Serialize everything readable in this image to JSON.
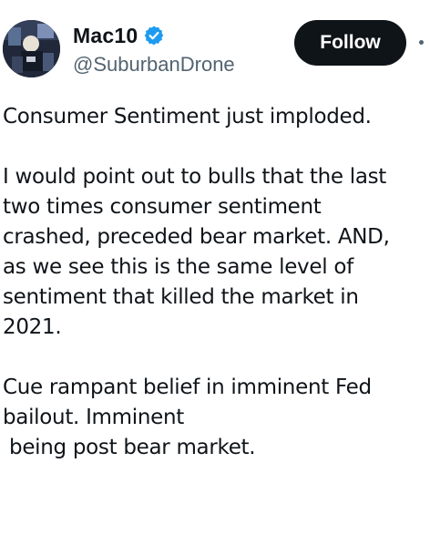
{
  "author": {
    "display_name": "Mac10",
    "handle": "@SuburbanDrone",
    "verified_icon": "verified-badge-icon",
    "verified_color": "#1d9bf0"
  },
  "actions": {
    "follow_label": "Follow"
  },
  "tweet": {
    "paragraphs": [
      "Consumer Sentiment just imploded.",
      "I would point out to bulls that the last\ntwo times consumer sentiment\ncrashed, preceded bear market. AND,\nas we see this is the same level of\nsentiment that killed the market in\n2021.",
      "Cue rampant belief in imminent Fed\nbailout. Imminent\n being post bear market."
    ]
  }
}
